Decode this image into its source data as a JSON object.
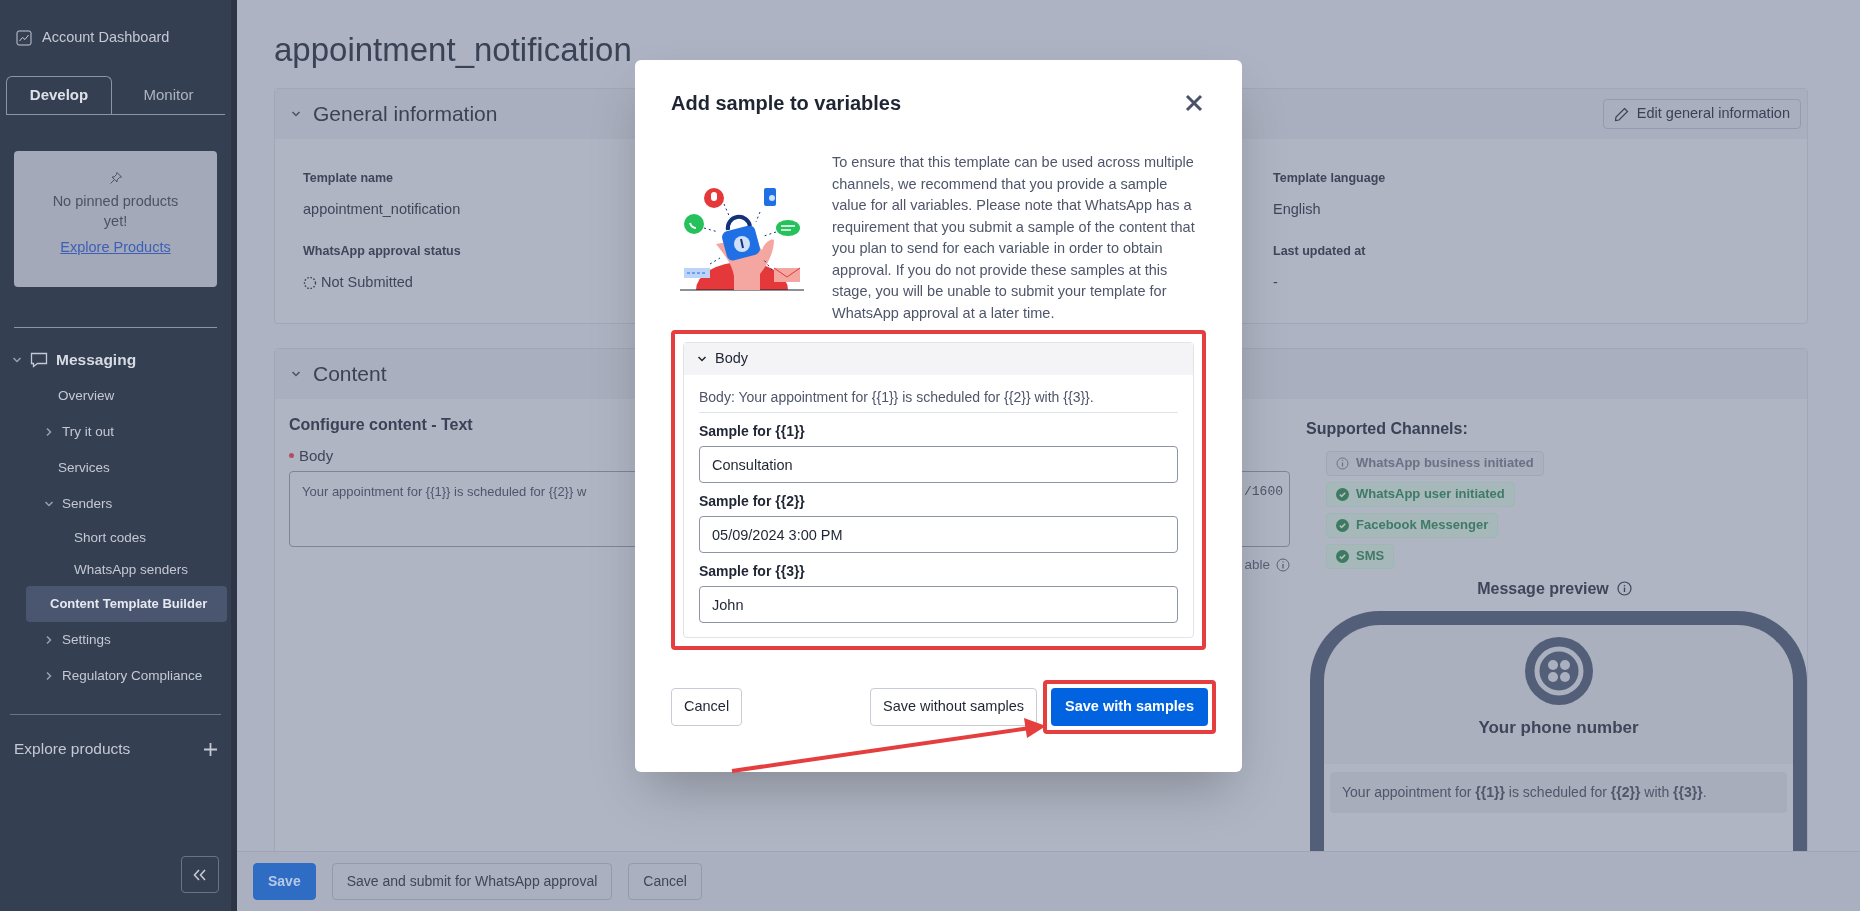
{
  "sidebar": {
    "dashboard_link": "Account Dashboard",
    "tabs": [
      {
        "label": "Develop",
        "selected": true
      },
      {
        "label": "Monitor",
        "selected": false
      }
    ],
    "pinned": {
      "message": "No pinned products yet!",
      "link": "Explore Products"
    },
    "nav": [
      {
        "label": "Messaging",
        "expanded": true,
        "selected": false,
        "children": [
          {
            "label": "Overview",
            "selected": false
          },
          {
            "label": "Try it out",
            "expanded": false,
            "selected": false
          },
          {
            "label": "Services",
            "selected": false
          },
          {
            "label": "Senders",
            "expanded": true,
            "selected": false,
            "children": [
              {
                "label": "Short codes",
                "selected": false
              },
              {
                "label": "WhatsApp senders",
                "selected": false
              }
            ]
          },
          {
            "label": "Content Template Builder",
            "selected": true
          },
          {
            "label": "Settings",
            "expanded": false,
            "selected": false
          },
          {
            "label": "Regulatory Compliance",
            "expanded": false,
            "selected": false
          }
        ]
      }
    ],
    "explore": "Explore products"
  },
  "page": {
    "title": "appointment_notification",
    "general": {
      "heading": "General information",
      "expanded": true,
      "edit_button": "Edit general information",
      "fields": [
        {
          "label": "Template name",
          "value": "appointment_notification",
          "kind": "text"
        },
        {
          "label": "Template language",
          "value": "English",
          "kind": "text"
        },
        {
          "label": "WhatsApp approval status",
          "value": "Not Submitted",
          "kind": "status"
        },
        {
          "label": "Last updated at",
          "value": "-",
          "kind": "text"
        }
      ]
    },
    "content": {
      "heading": "Content",
      "expanded": true,
      "configure_heading": "Configure content - Text",
      "body_label": "Body",
      "required": true,
      "body_text": "Your appointment for {{1}} is scheduled for {{2}} w",
      "counter": "/1600",
      "hint": "able",
      "channels_heading": "Supported Channels:",
      "channels": [
        {
          "label": "WhatsApp business initiated",
          "kind": "info"
        },
        {
          "label": "WhatsApp user initiated",
          "kind": "check"
        },
        {
          "label": "Facebook Messenger",
          "kind": "check"
        },
        {
          "label": "SMS",
          "kind": "check"
        }
      ],
      "preview_heading": "Message preview",
      "preview_name": "Your phone number",
      "preview_message": "Your appointment for **{{1}}** is scheduled for **{{2}}** with **{{3}}**."
    }
  },
  "footer_buttons": [
    {
      "label": "Save",
      "kind": "primary"
    },
    {
      "label": "Save and submit for WhatsApp approval",
      "kind": "secondary"
    },
    {
      "label": "Cancel",
      "kind": "secondary"
    }
  ],
  "modal": {
    "title": "Add sample to variables",
    "description": "To ensure that this template can be used across multiple channels, we recommend that you provide a sample value for all variables. Please note that WhatsApp has a requirement that you submit a sample of the content that you plan to send for each variable in order to obtain approval. If you do not provide these samples at this stage, you will be unable to submit your template for WhatsApp approval at a later time.",
    "section": {
      "title": "Body",
      "expanded": true,
      "template": "Body: Your appointment for {{1}} is scheduled for {{2}} with {{3}}.",
      "samples": [
        {
          "label": "Sample for {{1}}",
          "value": "Consultation"
        },
        {
          "label": "Sample for {{2}}",
          "value": "05/09/2024 3:00 PM"
        },
        {
          "label": "Sample for {{3}}",
          "value": "John"
        }
      ]
    },
    "buttons": [
      {
        "label": "Cancel",
        "kind": "secondary"
      },
      {
        "label": "Save without samples",
        "kind": "secondary"
      },
      {
        "label": "Save with samples",
        "kind": "primary"
      }
    ]
  }
}
